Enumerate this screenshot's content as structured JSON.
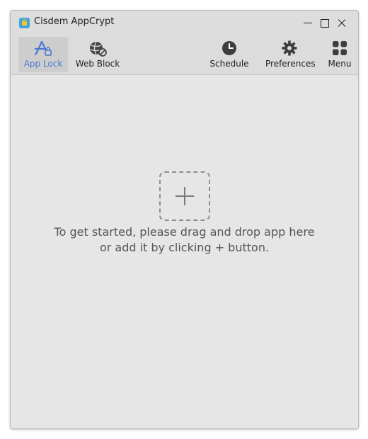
{
  "window": {
    "title": "Cisdem AppCrypt",
    "controls": [
      "minimize",
      "maximize",
      "close"
    ]
  },
  "toolbar": {
    "items": [
      {
        "label": "App Lock",
        "icon": "app-lock-icon",
        "active": true
      },
      {
        "label": "Web Block",
        "icon": "web-block-icon",
        "active": false
      },
      {
        "label": "Schedule",
        "icon": "clock-icon",
        "active": false
      },
      {
        "label": "Preferences",
        "icon": "gear-icon",
        "active": false
      },
      {
        "label": "Menu",
        "icon": "grid-menu-icon",
        "active": false
      }
    ]
  },
  "main": {
    "add_icon": "plus-icon",
    "hint_line1": "To get started, please drag and drop app here",
    "hint_line2": "or add it by clicking + button."
  },
  "colors": {
    "accent": "#4a78d6",
    "background": "#e6e6e6",
    "toolbar": "#dcdcdc"
  }
}
